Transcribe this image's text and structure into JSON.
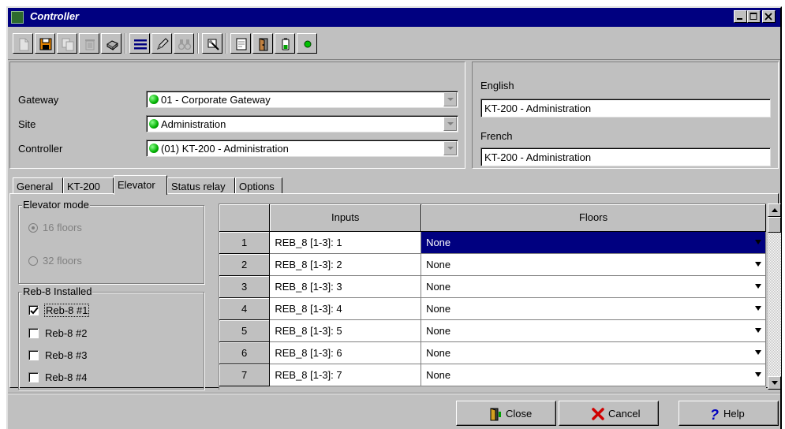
{
  "window": {
    "title": "Controller"
  },
  "toolbar": {
    "buttons": [
      "new",
      "save",
      "copy",
      "delete",
      "print",
      "list",
      "edit",
      "find",
      "tools",
      "report",
      "door",
      "battery",
      "status-light"
    ]
  },
  "location": {
    "gateway_label": "Gateway",
    "gateway_value": "01 - Corporate Gateway",
    "site_label": "Site",
    "site_value": "Administration",
    "controller_label": "Controller",
    "controller_value": "(01) KT-200 - Administration",
    "status_color": "#00b000"
  },
  "description": {
    "english_label": "English",
    "english_value": "KT-200 - Administration",
    "french_label": "French",
    "french_value": "KT-200 - Administration"
  },
  "tabs": [
    "General",
    "KT-200",
    "Elevator",
    "Status relay",
    "Options"
  ],
  "active_tab": "Elevator",
  "elevator_mode": {
    "title": "Elevator mode",
    "options": [
      "16 floors",
      "32 floors"
    ],
    "selected": "16 floors"
  },
  "reb8": {
    "title": "Reb-8 Installed",
    "items": [
      {
        "label": "Reb-8 #1",
        "checked": true
      },
      {
        "label": "Reb-8 #2",
        "checked": false
      },
      {
        "label": "Reb-8 #3",
        "checked": false
      },
      {
        "label": "Reb-8 #4",
        "checked": false
      }
    ]
  },
  "grid": {
    "headers": [
      "",
      "Inputs",
      "Floors"
    ],
    "rows": [
      {
        "num": "1",
        "input": "REB_8 [1-3]: 1",
        "floor": "None",
        "selected": true
      },
      {
        "num": "2",
        "input": "REB_8 [1-3]: 2",
        "floor": "None",
        "selected": false
      },
      {
        "num": "3",
        "input": "REB_8 [1-3]: 3",
        "floor": "None",
        "selected": false
      },
      {
        "num": "4",
        "input": "REB_8 [1-3]: 4",
        "floor": "None",
        "selected": false
      },
      {
        "num": "5",
        "input": "REB_8 [1-3]: 5",
        "floor": "None",
        "selected": false
      },
      {
        "num": "6",
        "input": "REB_8 [1-3]: 6",
        "floor": "None",
        "selected": false
      },
      {
        "num": "7",
        "input": "REB_8 [1-3]: 7",
        "floor": "None",
        "selected": false
      }
    ]
  },
  "buttons": {
    "close": "Close",
    "cancel": "Cancel",
    "help": "Help"
  },
  "colors": {
    "titlebar": "#000080",
    "selection": "#000080",
    "face": "#c0c0c0"
  }
}
